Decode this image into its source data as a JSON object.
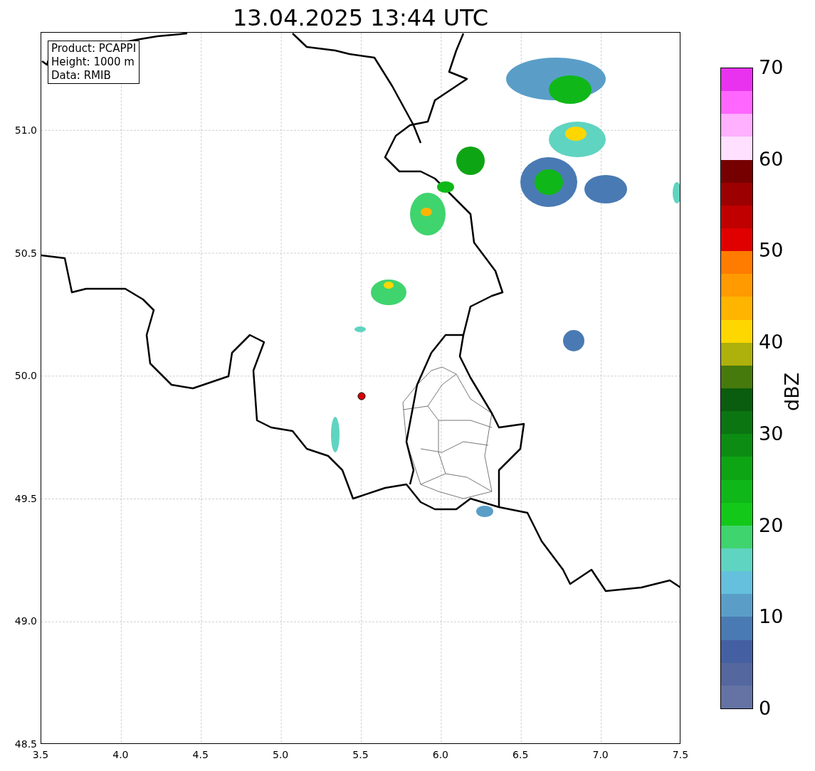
{
  "title": "13.04.2025 13:44 UTC",
  "info_box": [
    "Product: PCAPPI",
    "Height: 1000 m",
    "Data: RMIB"
  ],
  "x_ticks": [
    "3.5",
    "4.0",
    "4.5",
    "5.0",
    "5.5",
    "6.0",
    "6.5",
    "7.0",
    "7.5"
  ],
  "y_ticks": [
    "51.0",
    "50.5",
    "50.0",
    "49.5",
    "49.0",
    "48.5"
  ],
  "colorbar": {
    "label": "dBZ",
    "ticks": [
      "70",
      "60",
      "50",
      "40",
      "30",
      "20",
      "10",
      "0"
    ]
  }
}
